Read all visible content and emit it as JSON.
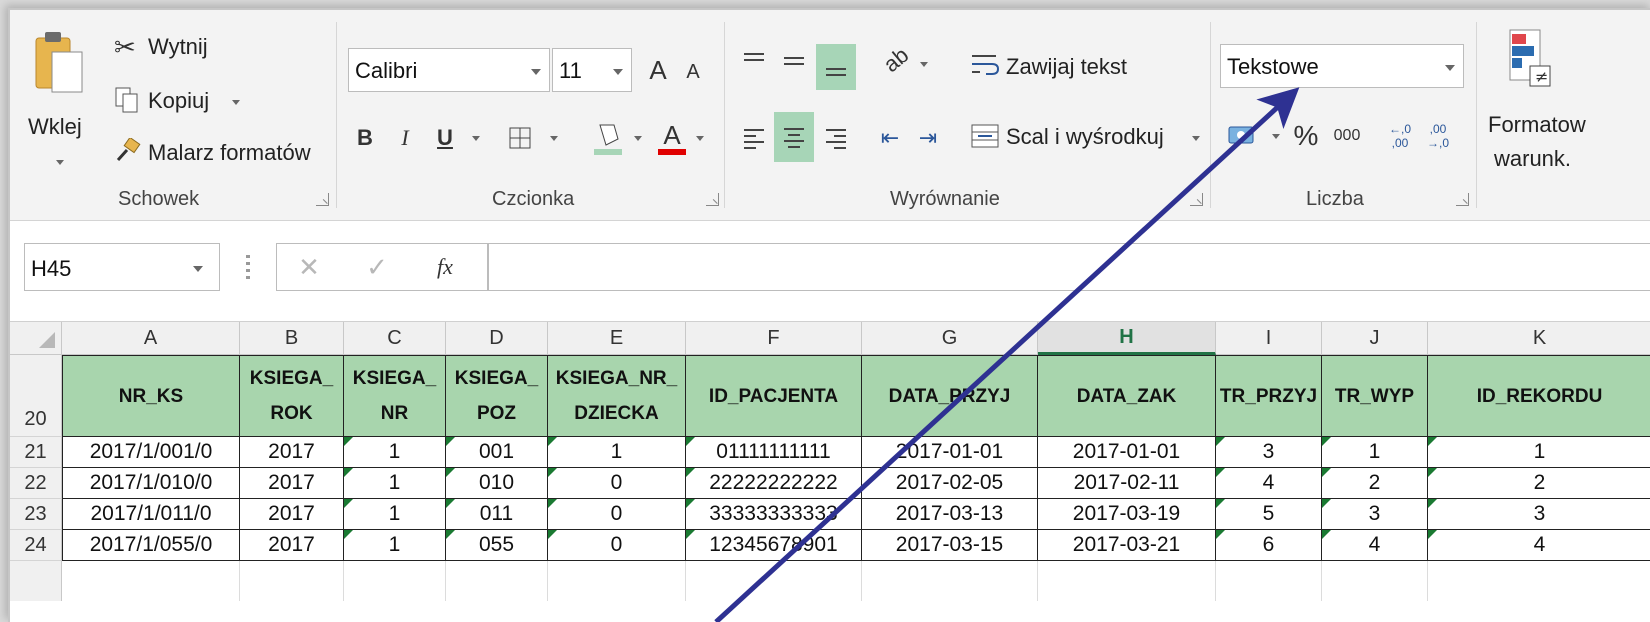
{
  "ribbon": {
    "clipboard": {
      "paste": "Wklej",
      "cut": "Wytnij",
      "copy": "Kopiuj",
      "format_painter": "Malarz formatów",
      "group": "Schowek"
    },
    "font": {
      "name": "Calibri",
      "size": "11",
      "bold": "B",
      "italic": "I",
      "underline": "U",
      "grow": "A",
      "shrink": "A",
      "color_letter": "A",
      "group": "Czcionka"
    },
    "alignment": {
      "wrap": "Zawijaj tekst",
      "merge": "Scal i wyśrodkuj",
      "group": "Wyrównanie"
    },
    "number": {
      "format": "Tekstowe",
      "percent": "%",
      "thousands": "000",
      "inc_dec": "←,0 ,00",
      "dec_dec": ",00 →,0",
      "group": "Liczba"
    },
    "styles": {
      "cond_line1": "Formatow",
      "cond_line2": "warunk."
    }
  },
  "formula_bar": {
    "name_box": "H45",
    "cancel": "✕",
    "enter": "✓",
    "fx": "fx",
    "value": ""
  },
  "columns": [
    "A",
    "B",
    "C",
    "D",
    "E",
    "F",
    "G",
    "H",
    "I",
    "J",
    "K"
  ],
  "selected_column": "H",
  "header_row": {
    "number": "20",
    "cells": [
      [
        "NR_KS"
      ],
      [
        "KSIEGA_",
        "ROK"
      ],
      [
        "KSIEGA_",
        "NR"
      ],
      [
        "KSIEGA_",
        "POZ"
      ],
      [
        "KSIEGA_NR_",
        "DZIECKA"
      ],
      [
        "ID_PACJENTA"
      ],
      [
        "DATA_PRZYJ"
      ],
      [
        "DATA_ZAK"
      ],
      [
        "TR_PRZYJ"
      ],
      [
        "TR_WYP"
      ],
      [
        "ID_REKORDU"
      ]
    ]
  },
  "rows": [
    {
      "number": "21",
      "cells": [
        "2017/1/001/0",
        "2017",
        "1",
        "001",
        "1",
        "01111111111",
        "2017-01-01",
        "2017-01-01",
        "3",
        "1",
        "1"
      ]
    },
    {
      "number": "22",
      "cells": [
        "2017/1/010/0",
        "2017",
        "1",
        "010",
        "0",
        "22222222222",
        "2017-02-05",
        "2017-02-11",
        "4",
        "2",
        "2"
      ]
    },
    {
      "number": "23",
      "cells": [
        "2017/1/011/0",
        "2017",
        "1",
        "011",
        "0",
        "33333333333",
        "2017-03-13",
        "2017-03-19",
        "5",
        "3",
        "3"
      ]
    },
    {
      "number": "24",
      "cells": [
        "2017/1/055/0",
        "2017",
        "1",
        "055",
        "0",
        "12345678901",
        "2017-03-15",
        "2017-03-21",
        "6",
        "4",
        "4"
      ]
    }
  ],
  "text_flag_columns": [
    2,
    3,
    4,
    5,
    8,
    9,
    10
  ],
  "colors": {
    "header_fill": "#a8d5ad",
    "accent": "#217346",
    "arrow": "#2e3192",
    "text_marker": "#1a7a32"
  }
}
